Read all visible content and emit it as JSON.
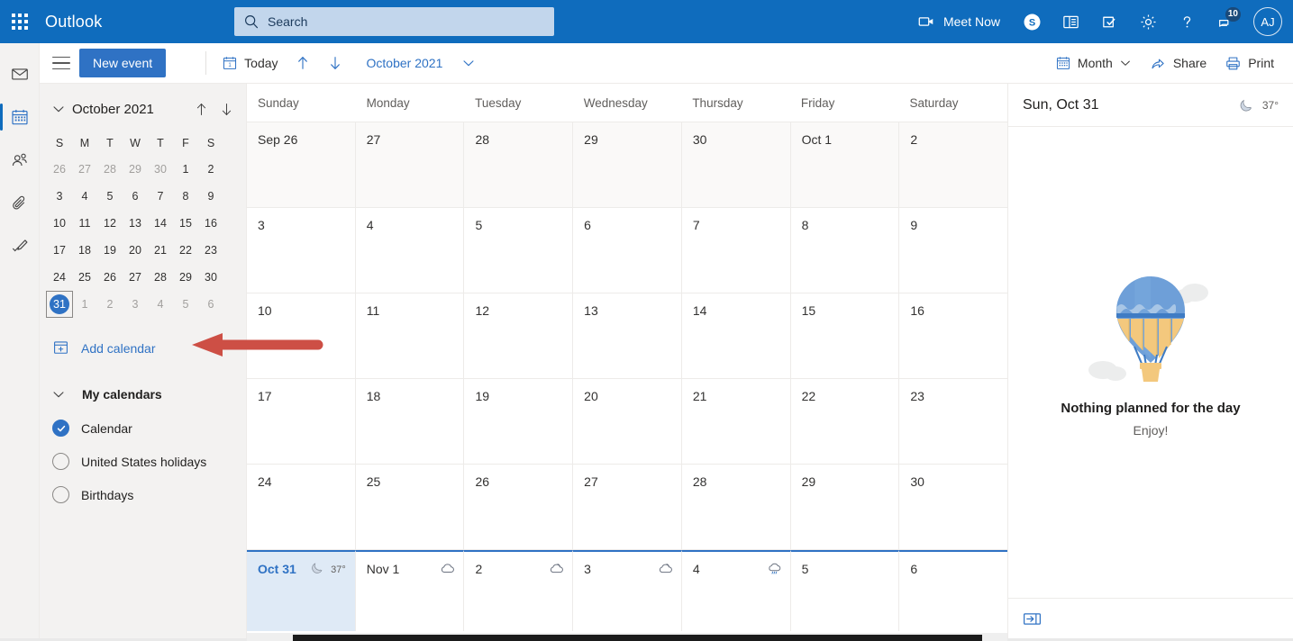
{
  "topbar": {
    "waffle_label": "app-launcher",
    "brand": "Outlook",
    "search_placeholder": "Search",
    "meet_now": "Meet Now",
    "notification_count": "10",
    "avatar_initials": "AJ",
    "bg_color": "#0f6cbd",
    "items": [
      {
        "name": "skype-icon",
        "label": "Skype"
      },
      {
        "name": "office-icon",
        "label": "Office"
      },
      {
        "name": "tasks-icon",
        "label": "To Do"
      },
      {
        "name": "gear-icon",
        "label": "Settings"
      },
      {
        "name": "help-icon",
        "label": "Help"
      },
      {
        "name": "feedback-icon",
        "label": "Feedback"
      }
    ]
  },
  "rail": {
    "items": [
      {
        "name": "mail-icon",
        "label": "Mail",
        "selected": false
      },
      {
        "name": "calendar-icon",
        "label": "Calendar",
        "selected": true
      },
      {
        "name": "people-icon",
        "label": "People",
        "selected": false
      },
      {
        "name": "files-icon",
        "label": "Files",
        "selected": false
      },
      {
        "name": "todo-icon",
        "label": "To Do",
        "selected": false
      }
    ]
  },
  "toolbar": {
    "new_event": "New event",
    "today": "Today",
    "date_label": "October 2021",
    "view": "Month",
    "share": "Share",
    "print": "Print"
  },
  "sidebar": {
    "minicalendar": {
      "title": "October 2021",
      "dow": [
        "S",
        "M",
        "T",
        "W",
        "T",
        "F",
        "S"
      ],
      "weeks": [
        [
          {
            "d": "26",
            "out": true
          },
          {
            "d": "27",
            "out": true
          },
          {
            "d": "28",
            "out": true
          },
          {
            "d": "29",
            "out": true
          },
          {
            "d": "30",
            "out": true
          },
          {
            "d": "1",
            "out": false
          },
          {
            "d": "2",
            "out": false
          }
        ],
        [
          {
            "d": "3",
            "out": false
          },
          {
            "d": "4",
            "out": false
          },
          {
            "d": "5",
            "out": false
          },
          {
            "d": "6",
            "out": false
          },
          {
            "d": "7",
            "out": false
          },
          {
            "d": "8",
            "out": false
          },
          {
            "d": "9",
            "out": false
          }
        ],
        [
          {
            "d": "10",
            "out": false
          },
          {
            "d": "11",
            "out": false
          },
          {
            "d": "12",
            "out": false
          },
          {
            "d": "13",
            "out": false
          },
          {
            "d": "14",
            "out": false
          },
          {
            "d": "15",
            "out": false
          },
          {
            "d": "16",
            "out": false
          }
        ],
        [
          {
            "d": "17",
            "out": false
          },
          {
            "d": "18",
            "out": false
          },
          {
            "d": "19",
            "out": false
          },
          {
            "d": "20",
            "out": false
          },
          {
            "d": "21",
            "out": false
          },
          {
            "d": "22",
            "out": false
          },
          {
            "d": "23",
            "out": false
          }
        ],
        [
          {
            "d": "24",
            "out": false
          },
          {
            "d": "25",
            "out": false
          },
          {
            "d": "26",
            "out": false
          },
          {
            "d": "27",
            "out": false
          },
          {
            "d": "28",
            "out": false
          },
          {
            "d": "29",
            "out": false
          },
          {
            "d": "30",
            "out": false
          }
        ],
        [
          {
            "d": "31",
            "out": false,
            "today": true
          },
          {
            "d": "1",
            "out": true
          },
          {
            "d": "2",
            "out": true
          },
          {
            "d": "3",
            "out": true
          },
          {
            "d": "4",
            "out": true
          },
          {
            "d": "5",
            "out": true
          },
          {
            "d": "6",
            "out": true
          }
        ]
      ]
    },
    "add_calendar": "Add calendar",
    "my_calendars": "My calendars",
    "calendars": [
      {
        "label": "Calendar",
        "checked": true
      },
      {
        "label": "United States holidays",
        "checked": false
      },
      {
        "label": "Birthdays",
        "checked": false
      }
    ]
  },
  "calendar": {
    "dow_headers": [
      "Sunday",
      "Monday",
      "Tuesday",
      "Wednesday",
      "Thursday",
      "Friday",
      "Saturday"
    ],
    "weeks": [
      {
        "dim": true,
        "days": [
          {
            "num": "Sep 26"
          },
          {
            "num": "27"
          },
          {
            "num": "28"
          },
          {
            "num": "29"
          },
          {
            "num": "30"
          },
          {
            "num": "Oct 1"
          },
          {
            "num": "2"
          }
        ]
      },
      {
        "dim": false,
        "days": [
          {
            "num": "3"
          },
          {
            "num": "4"
          },
          {
            "num": "5"
          },
          {
            "num": "6"
          },
          {
            "num": "7"
          },
          {
            "num": "8"
          },
          {
            "num": "9"
          }
        ]
      },
      {
        "dim": false,
        "days": [
          {
            "num": "10"
          },
          {
            "num": "11"
          },
          {
            "num": "12"
          },
          {
            "num": "13"
          },
          {
            "num": "14"
          },
          {
            "num": "15"
          },
          {
            "num": "16"
          }
        ]
      },
      {
        "dim": false,
        "days": [
          {
            "num": "17"
          },
          {
            "num": "18"
          },
          {
            "num": "19"
          },
          {
            "num": "20"
          },
          {
            "num": "21"
          },
          {
            "num": "22"
          },
          {
            "num": "23"
          }
        ]
      },
      {
        "dim": false,
        "days": [
          {
            "num": "24"
          },
          {
            "num": "25"
          },
          {
            "num": "26"
          },
          {
            "num": "27"
          },
          {
            "num": "28"
          },
          {
            "num": "29"
          },
          {
            "num": "30"
          }
        ]
      },
      {
        "dim": false,
        "last": true,
        "days": [
          {
            "num": "Oct 31",
            "selected": true,
            "weather": {
              "icon": "moon-icon",
              "temp": "37°"
            }
          },
          {
            "num": "Nov 1",
            "weather": {
              "icon": "cloud-icon"
            }
          },
          {
            "num": "2",
            "weather": {
              "icon": "partly-cloudy-icon"
            }
          },
          {
            "num": "3",
            "weather": {
              "icon": "partly-cloudy-icon"
            }
          },
          {
            "num": "4",
            "weather": {
              "icon": "rain-icon"
            }
          },
          {
            "num": "5"
          },
          {
            "num": "6"
          }
        ]
      }
    ]
  },
  "right_panel": {
    "title": "Sun, Oct 31",
    "weather_temp": "37°",
    "weather_icon": "moon-icon",
    "empty_message": "Nothing planned for the day",
    "empty_sub": "Enjoy!",
    "footer_icon": "expand-pane-icon"
  },
  "annotation": {
    "arrow_color": "#cd4f45",
    "points_to": "Add calendar"
  }
}
